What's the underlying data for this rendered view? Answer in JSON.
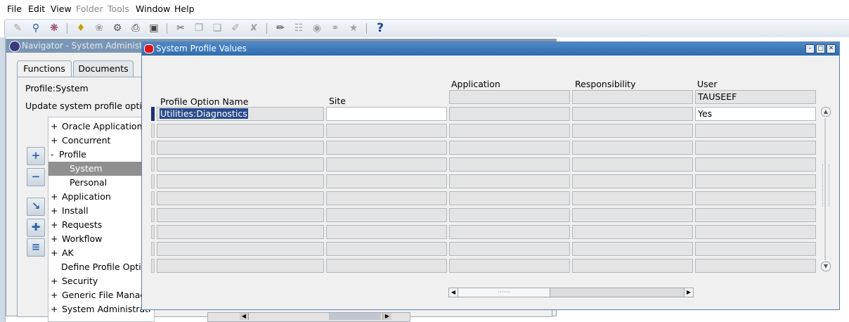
{
  "menu": {
    "file": "File",
    "edit": "Edit",
    "view": "View",
    "folder": "Folder",
    "tools": "Tools",
    "window": "Window",
    "help": "Help"
  },
  "toolbar": {
    "help_glyph": "?"
  },
  "navigator": {
    "title": "Navigator - System Administrat",
    "tabs": [
      "Functions",
      "Documents"
    ],
    "profile_label": "Profile:System",
    "update_text": "Update system profile option",
    "tree": [
      {
        "prefix": "+",
        "label": "Oracle Applications"
      },
      {
        "prefix": "+",
        "label": "Concurrent"
      },
      {
        "prefix": "-",
        "label": "Profile"
      },
      {
        "prefix": "",
        "label": "System"
      },
      {
        "prefix": "",
        "label": "Personal"
      },
      {
        "prefix": "+",
        "label": "Application"
      },
      {
        "prefix": "+",
        "label": "Install"
      },
      {
        "prefix": "+",
        "label": "Requests"
      },
      {
        "prefix": "+",
        "label": "Workflow"
      },
      {
        "prefix": "+",
        "label": "AK"
      },
      {
        "prefix": "",
        "label": "Define Profile Option"
      },
      {
        "prefix": "+",
        "label": "Security"
      },
      {
        "prefix": "+",
        "label": "Generic File Manag"
      },
      {
        "prefix": "+",
        "label": "System Administrati"
      }
    ]
  },
  "profile_window": {
    "title": "System Profile Values",
    "columns": {
      "option": "Profile Option Name",
      "site": "Site",
      "application": "Application",
      "responsibility": "Responsibility",
      "user": "User"
    },
    "user_header_value": "TAUSEEF",
    "rows": [
      {
        "option": "Utilities:Diagnostics",
        "site": "",
        "application": "",
        "responsibility": "",
        "user": "Yes"
      },
      {
        "option": "",
        "site": "",
        "application": "",
        "responsibility": "",
        "user": ""
      },
      {
        "option": "",
        "site": "",
        "application": "",
        "responsibility": "",
        "user": ""
      },
      {
        "option": "",
        "site": "",
        "application": "",
        "responsibility": "",
        "user": ""
      },
      {
        "option": "",
        "site": "",
        "application": "",
        "responsibility": "",
        "user": ""
      },
      {
        "option": "",
        "site": "",
        "application": "",
        "responsibility": "",
        "user": ""
      },
      {
        "option": "",
        "site": "",
        "application": "",
        "responsibility": "",
        "user": ""
      },
      {
        "option": "",
        "site": "",
        "application": "",
        "responsibility": "",
        "user": ""
      },
      {
        "option": "",
        "site": "",
        "application": "",
        "responsibility": "",
        "user": ""
      },
      {
        "option": "",
        "site": "",
        "application": "",
        "responsibility": "",
        "user": ""
      }
    ]
  }
}
